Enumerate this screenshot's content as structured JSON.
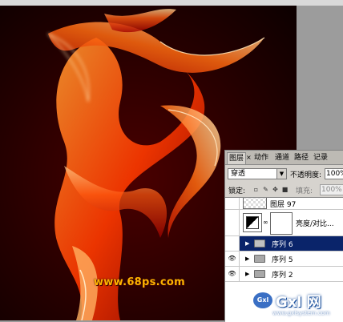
{
  "panel": {
    "tabs": [
      "图层",
      "×",
      "动作",
      "通道",
      "路径",
      "记录"
    ],
    "blend_mode": "穿透",
    "opacity_label": "不透明度:",
    "opacity_value": "100%",
    "lock_label": "锁定:",
    "fill_label": "填充:",
    "fill_value": "100%",
    "layers": [
      {
        "name": "图层 97",
        "type": "layer",
        "visible": false
      },
      {
        "name": "亮度/对比...",
        "type": "adjustment",
        "visible": false
      },
      {
        "name": "序列 6",
        "type": "group",
        "visible": true,
        "selected": true
      },
      {
        "name": "序列 5",
        "type": "group",
        "visible": true
      },
      {
        "name": "序列 2",
        "type": "group",
        "visible": true
      }
    ]
  },
  "watermark": "www.68ps.com",
  "logo": {
    "title": "Gxl 网",
    "icon": "Gxl",
    "sub": "www.gxlsystem.com"
  },
  "colors": {
    "background": "#1a0000",
    "flame": "#ff4a00",
    "selection": "#0a246a"
  }
}
